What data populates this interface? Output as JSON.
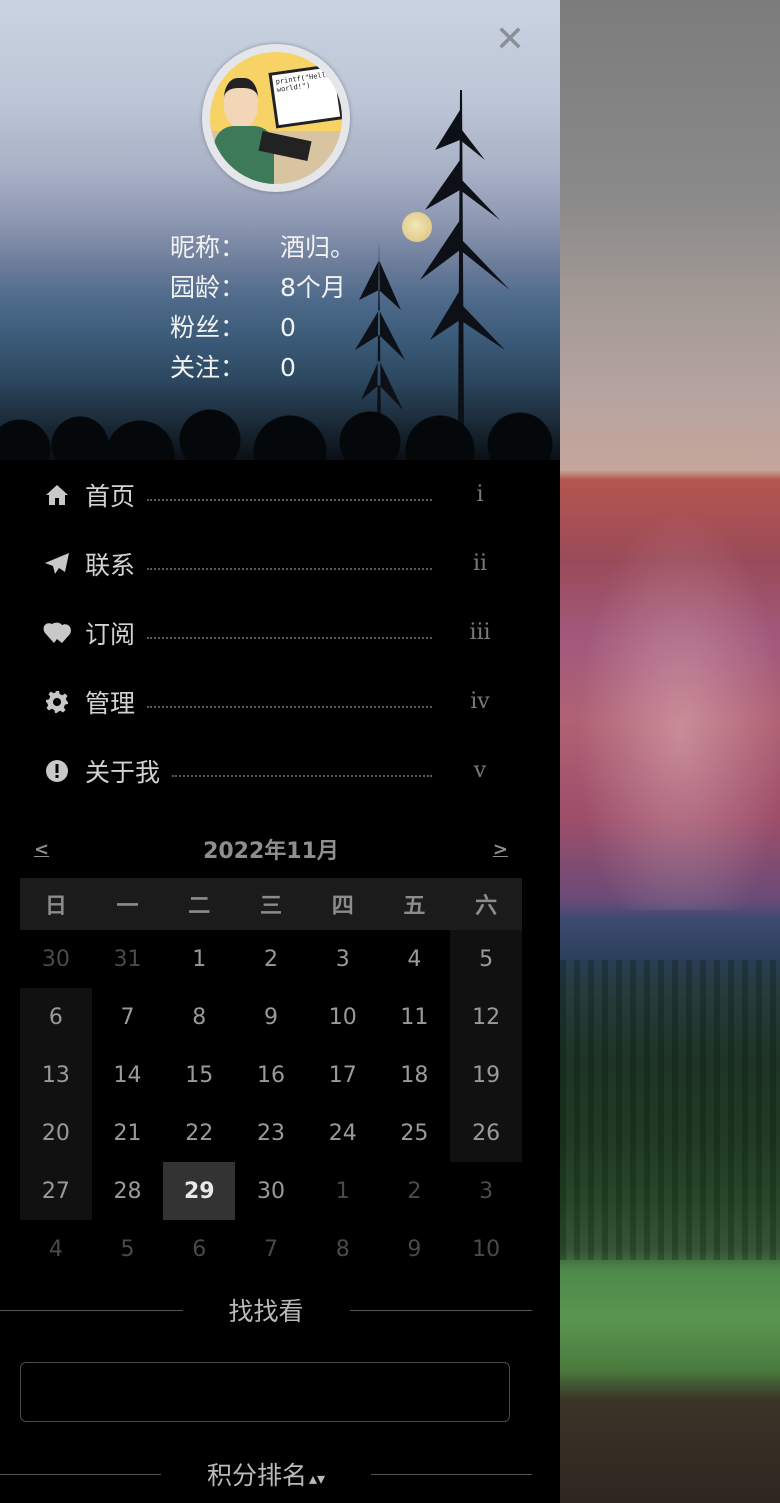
{
  "profile": {
    "nickname_label": "昵称：",
    "nickname": "酒归。",
    "age_label": "园龄：",
    "age": "8个月",
    "fans_label": "粉丝：",
    "fans": "0",
    "follow_label": "关注：",
    "follow": "0"
  },
  "nav": [
    {
      "label": "首页",
      "num": "i",
      "icon": "home-icon"
    },
    {
      "label": "联系",
      "num": "ii",
      "icon": "paper-plane-icon"
    },
    {
      "label": "订阅",
      "num": "iii",
      "icon": "heart-icon"
    },
    {
      "label": "管理",
      "num": "iv",
      "icon": "gear-icon"
    },
    {
      "label": "关于我",
      "num": "v",
      "icon": "alert-circle-icon"
    }
  ],
  "calendar": {
    "title": "2022年11月",
    "prev": "<",
    "next": ">",
    "weekdays": [
      "日",
      "一",
      "二",
      "三",
      "四",
      "五",
      "六"
    ],
    "weeks": [
      [
        "30",
        "31",
        "1",
        "2",
        "3",
        "4",
        "5"
      ],
      [
        "6",
        "7",
        "8",
        "9",
        "10",
        "11",
        "12"
      ],
      [
        "13",
        "14",
        "15",
        "16",
        "17",
        "18",
        "19"
      ],
      [
        "20",
        "21",
        "22",
        "23",
        "24",
        "25",
        "26"
      ],
      [
        "27",
        "28",
        "29",
        "30",
        "1",
        "2",
        "3"
      ],
      [
        "4",
        "5",
        "6",
        "7",
        "8",
        "9",
        "10"
      ]
    ],
    "today": "29"
  },
  "search": {
    "title": "找找看",
    "value": ""
  },
  "ranking": {
    "title": "积分排名"
  },
  "avatar_text": "printf(\"Hello world!\")"
}
